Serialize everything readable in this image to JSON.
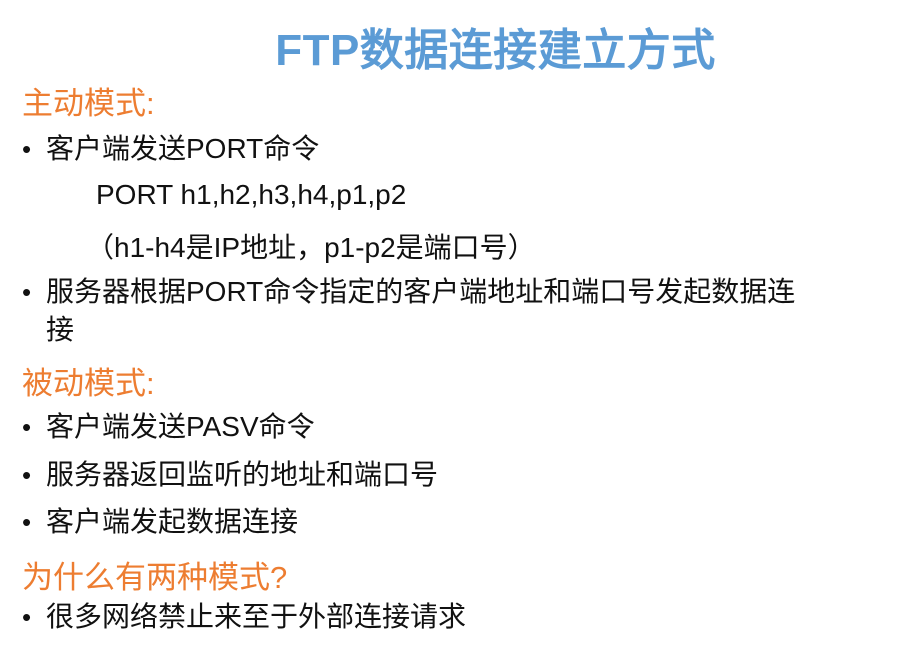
{
  "slide": {
    "title": "FTP数据连接建立方式",
    "active_mode": {
      "heading": "主动模式:",
      "bullet_1": "客户端发送PORT命令",
      "port_syntax": "PORT h1,h2,h3,h4,p1,p2",
      "port_note": "（h1-h4是IP地址，p1-p2是端口号）",
      "bullet_2_line_1": "服务器根据PORT命令指定的客户端地址和端口号发起数据连",
      "bullet_2_line_2": "接"
    },
    "passive_mode": {
      "heading": "被动模式:",
      "bullet_1": "客户端发送PASV命令",
      "bullet_2": "服务器返回监听的地址和端口号",
      "bullet_3": "客户端发起数据连接"
    },
    "why": {
      "heading": "为什么有两种模式?",
      "bullet_1": "很多网络禁止来至于外部连接请求"
    },
    "bullet_glyph": "•",
    "colors": {
      "title": "#5b9bd5",
      "heading": "#ed7d31",
      "text": "#111111"
    }
  }
}
